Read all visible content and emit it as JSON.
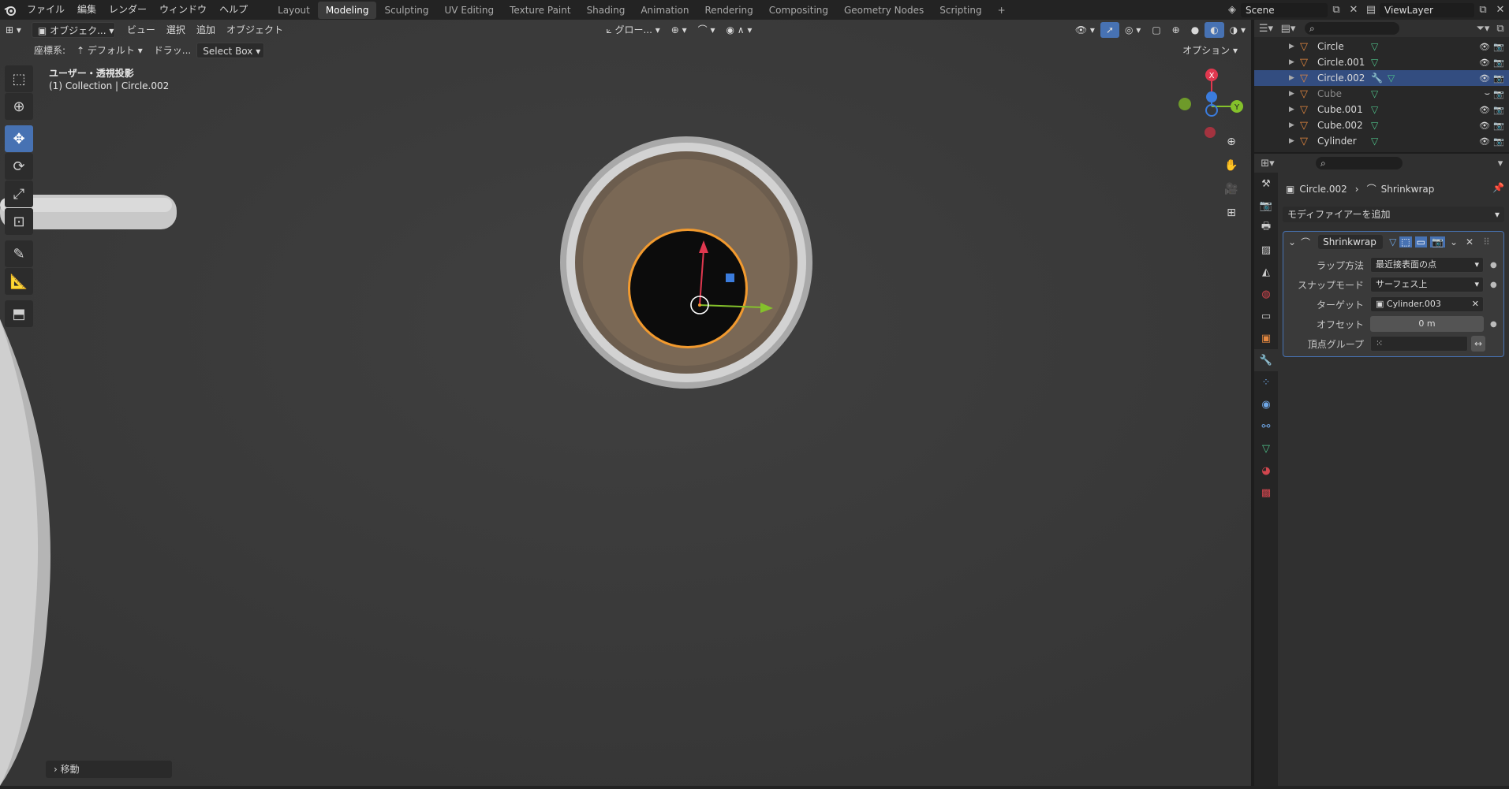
{
  "topbar": {
    "menus": [
      "ファイル",
      "編集",
      "レンダー",
      "ウィンドウ",
      "ヘルプ"
    ],
    "workspaces": [
      "Layout",
      "Modeling",
      "Sculpting",
      "UV Editing",
      "Texture Paint",
      "Shading",
      "Animation",
      "Rendering",
      "Compositing",
      "Geometry Nodes",
      "Scripting"
    ],
    "active_workspace": "Modeling",
    "add_tab": "+",
    "scene": "Scene",
    "viewlayer": "ViewLayer"
  },
  "viewport": {
    "mode": "オブジェク...",
    "menus": [
      "ビュー",
      "選択",
      "追加",
      "オブジェクト"
    ],
    "orientation": "グロー...",
    "coord_label": "座標系:",
    "coord_value": "デフォルト",
    "drag_label": "ドラッ...",
    "drag_value": "Select Box",
    "options": "オプション",
    "view_name": "ユーザー・透視投影",
    "collection_info": "(1) Collection | Circle.002",
    "last_op": "移動",
    "gizmo": {
      "x": "X",
      "y": "Y"
    }
  },
  "outliner": {
    "rows": [
      {
        "name": "Circle",
        "selected": false,
        "dim": false,
        "modifier": false
      },
      {
        "name": "Circle.001",
        "selected": false,
        "dim": false,
        "modifier": false
      },
      {
        "name": "Circle.002",
        "selected": true,
        "dim": false,
        "modifier": true
      },
      {
        "name": "Cube",
        "selected": false,
        "dim": true,
        "modifier": false
      },
      {
        "name": "Cube.001",
        "selected": false,
        "dim": false,
        "modifier": false
      },
      {
        "name": "Cube.002",
        "selected": false,
        "dim": false,
        "modifier": false
      },
      {
        "name": "Cylinder",
        "selected": false,
        "dim": false,
        "modifier": false
      }
    ]
  },
  "properties": {
    "breadcrumb_object": "Circle.002",
    "breadcrumb_modifier": "Shrinkwrap",
    "add_modifier": "モディファイアーを追加",
    "modifier_name": "Shrinkwrap",
    "fields": {
      "wrap_method_label": "ラップ方法",
      "wrap_method_value": "最近接表面の点",
      "snap_mode_label": "スナップモード",
      "snap_mode_value": "サーフェス上",
      "target_label": "ターゲット",
      "target_value": "Cylinder.003",
      "offset_label": "オフセット",
      "offset_value": "0 m",
      "vgroup_label": "頂点グループ",
      "vgroup_value": ""
    }
  },
  "colors": {
    "accent": "#4772b3",
    "selected_row": "#334d80",
    "object_orange": "#e3873f",
    "mesh_green": "#4fc28a",
    "axis_red": "#e0384f",
    "axis_green": "#84c12b",
    "axis_blue": "#3b7cdd"
  }
}
